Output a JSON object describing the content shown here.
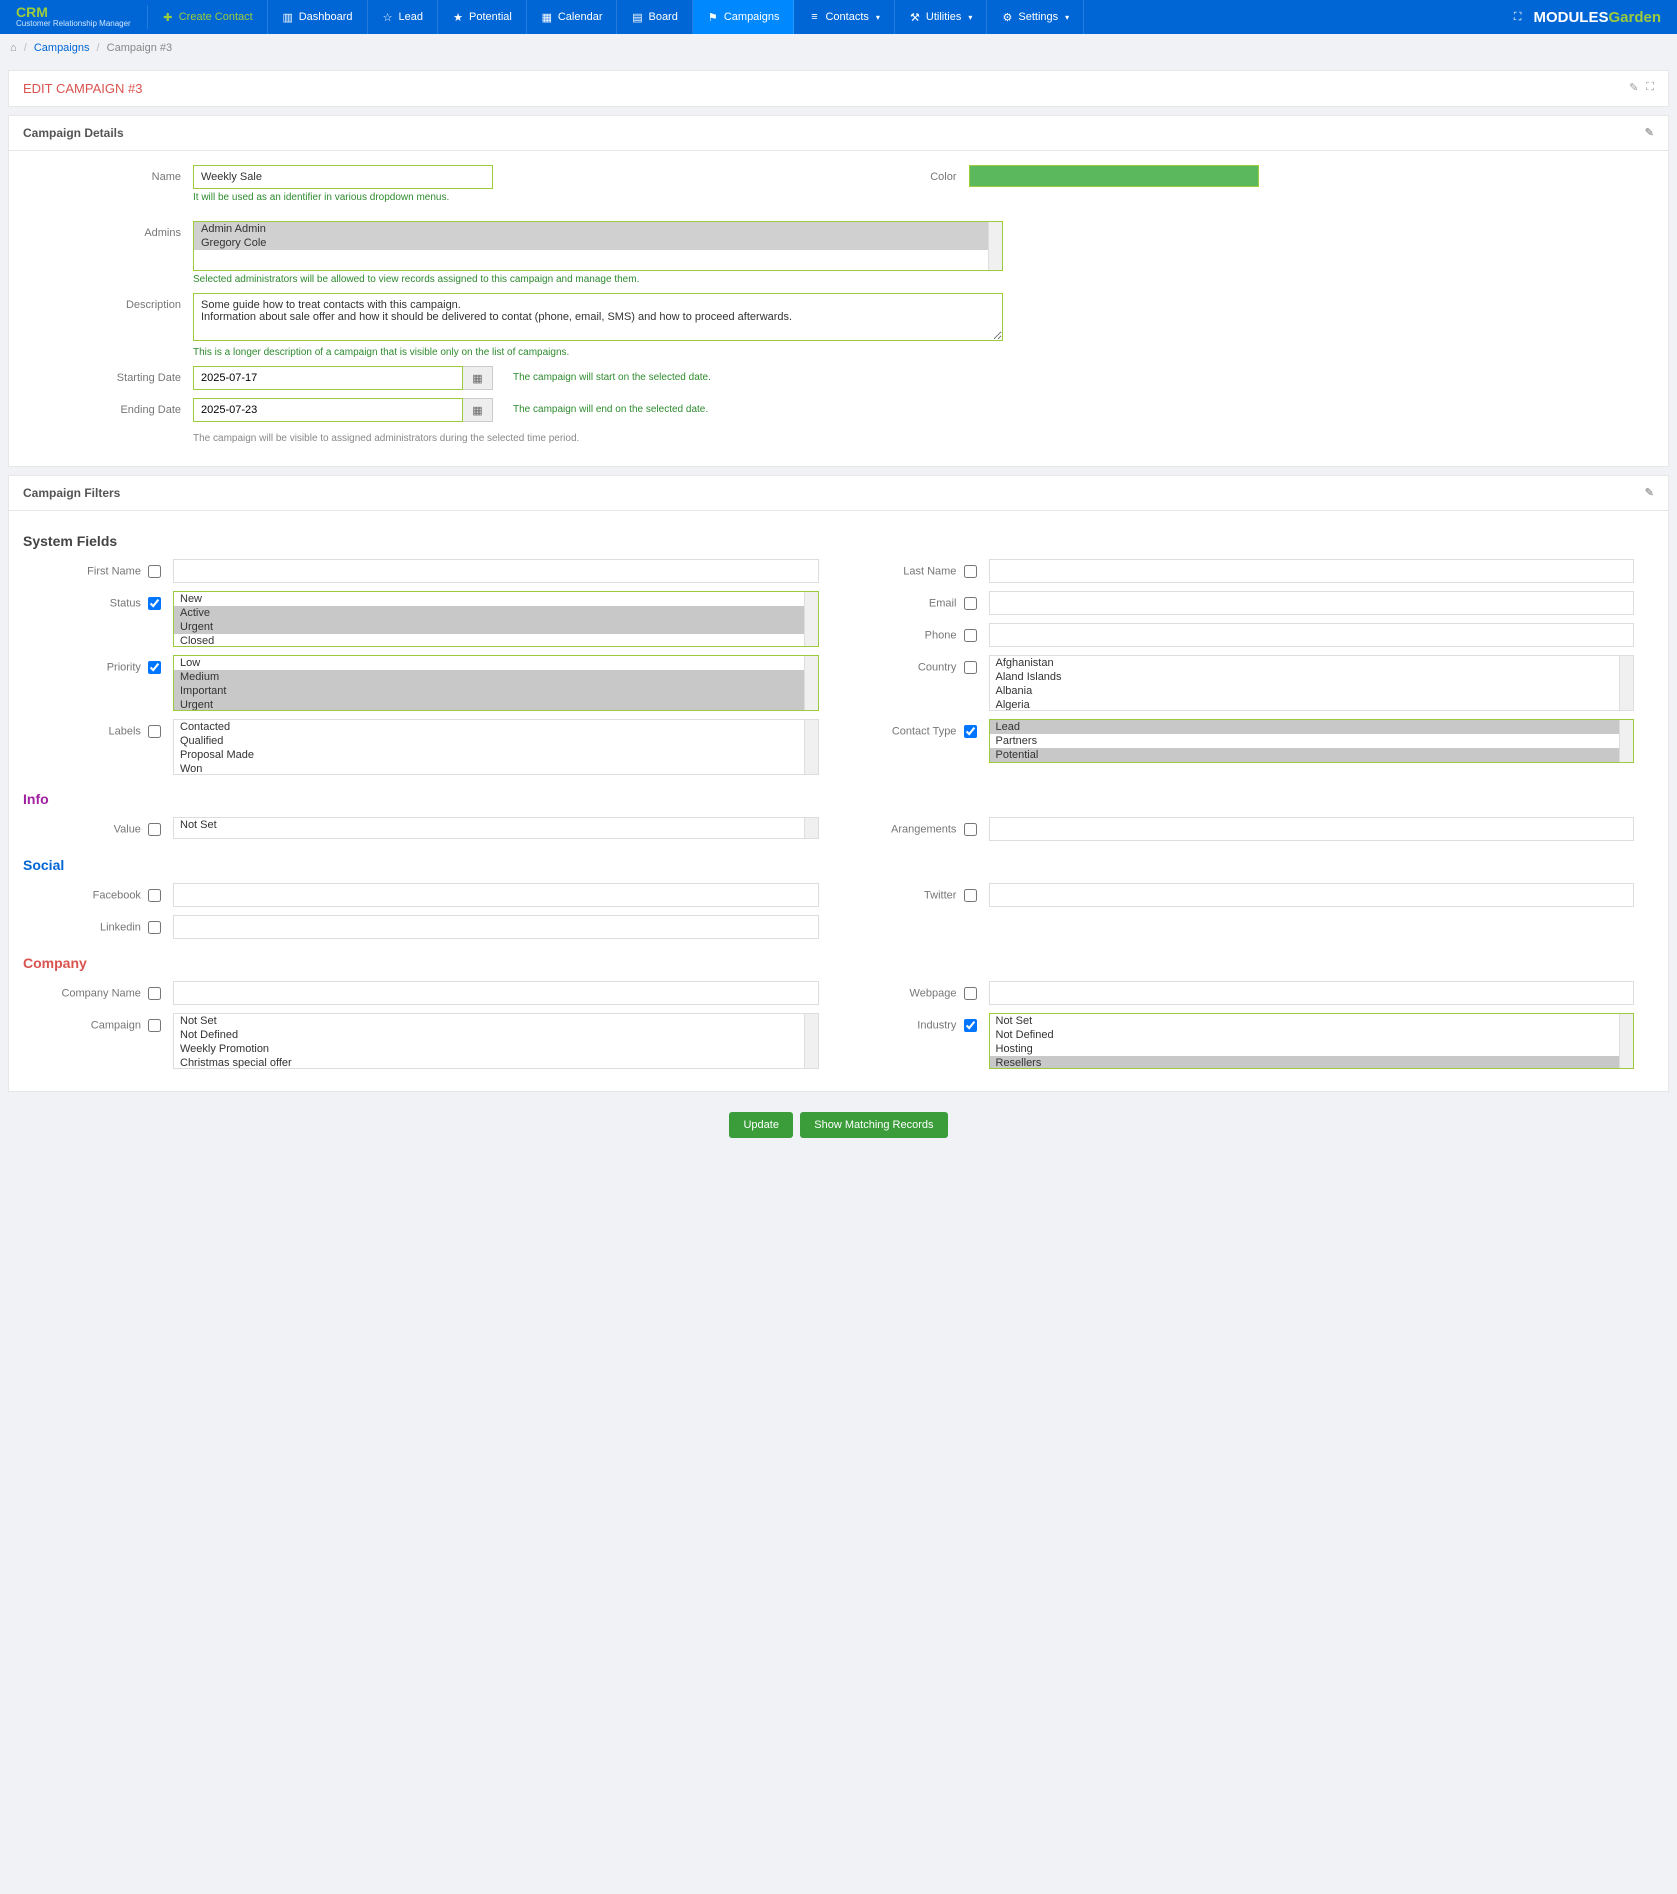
{
  "brand": {
    "title": "CRM",
    "subtitle": "Customer Relationship Manager"
  },
  "nav": {
    "create": "Create Contact",
    "items": [
      "Dashboard",
      "Lead",
      "Potential",
      "Calendar",
      "Board",
      "Campaigns",
      "Contacts",
      "Utilities",
      "Settings"
    ]
  },
  "breadcrumb": {
    "l1": "Campaigns",
    "l2": "Campaign #3"
  },
  "edit_title": "EDIT CAMPAIGN #3",
  "details": {
    "panel_title": "Campaign Details",
    "name_label": "Name",
    "name_value": "Weekly Sale",
    "name_help": "It will be used as an identifier in various dropdown menus.",
    "color_label": "Color",
    "admins_label": "Admins",
    "admins": [
      "Admin Admin",
      "Gregory Cole"
    ],
    "admins_help": "Selected administrators will be allowed to view records assigned to this campaign and manage them.",
    "desc_label": "Description",
    "desc_value": "Some guide how to treat contacts with this campaign.\nInformation about sale offer and how it should be delivered to contat (phone, email, SMS) and how to proceed afterwards.",
    "desc_help": "This is a longer description of a campaign that is visible only on the list of campaigns.",
    "start_label": "Starting Date",
    "start_value": "2025-07-17",
    "start_help": "The campaign will start on the selected date.",
    "end_label": "Ending Date",
    "end_value": "2025-07-23",
    "end_help": "The campaign will end on the selected date.",
    "visibility_help": "The campaign will be visible to assigned administrators during the selected time period."
  },
  "filters": {
    "panel_title": "Campaign Filters",
    "system_title": "System Fields",
    "firstname_label": "First Name",
    "lastname_label": "Last Name",
    "status_label": "Status",
    "status_opts": [
      "New",
      "Active",
      "Urgent",
      "Closed"
    ],
    "email_label": "Email",
    "phone_label": "Phone",
    "priority_label": "Priority",
    "priority_opts": [
      "Low",
      "Medium",
      "Important",
      "Urgent"
    ],
    "country_label": "Country",
    "country_opts": [
      "Afghanistan",
      "Aland Islands",
      "Albania",
      "Algeria"
    ],
    "labels_label": "Labels",
    "labels_opts": [
      "Contacted",
      "Qualified",
      "Proposal Made",
      "Won"
    ],
    "ctype_label": "Contact Type",
    "ctype_opts": [
      "Lead",
      "Partners",
      "Potential"
    ],
    "info_title": "Info",
    "value_label": "Value",
    "value_opts": [
      "Not Set"
    ],
    "arr_label": "Arangements",
    "social_title": "Social",
    "fb_label": "Facebook",
    "tw_label": "Twitter",
    "li_label": "Linkedin",
    "company_title": "Company",
    "cname_label": "Company Name",
    "web_label": "Webpage",
    "campaign_label": "Campaign",
    "campaign_opts": [
      "Not Set",
      "Not Defined",
      "Weekly Promotion",
      "Christmas special offer"
    ],
    "industry_label": "Industry",
    "industry_opts": [
      "Not Set",
      "Not Defined",
      "Hosting",
      "Resellers"
    ]
  },
  "buttons": {
    "update": "Update",
    "show": "Show Matching Records"
  },
  "logo": {
    "p1": "MODULES",
    "p2": "Garden"
  }
}
